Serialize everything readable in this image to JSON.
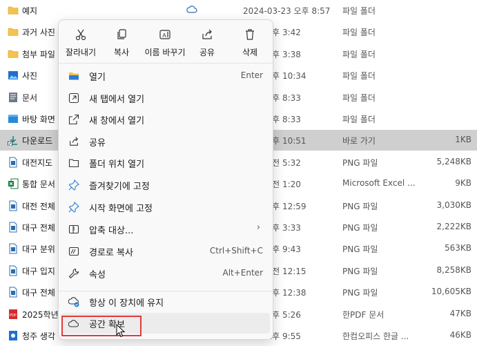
{
  "files": [
    {
      "name": "예지",
      "date": "2024-03-23 오후 8:57",
      "type": "파일 폴더",
      "size": "",
      "icon": "folder-icon",
      "synced": true
    },
    {
      "name": "과거 사진",
      "date": "7-03 오후 3:42",
      "type": "파일 폴더",
      "size": "",
      "icon": "folder-icon"
    },
    {
      "name": "첨부 파일",
      "date": "7-22 오후 3:38",
      "type": "파일 폴더",
      "size": "",
      "icon": "folder-icon"
    },
    {
      "name": "사진",
      "date": "3-02 오후 10:34",
      "type": "파일 폴더",
      "size": "",
      "icon": "pictures-folder-icon"
    },
    {
      "name": "문서",
      "date": "3-05 오후 8:33",
      "type": "파일 폴더",
      "size": "",
      "icon": "documents-folder-icon"
    },
    {
      "name": "바탕 화면",
      "date": "3-05 오후 8:33",
      "type": "파일 폴더",
      "size": "",
      "icon": "desktop-folder-icon"
    },
    {
      "name": "다운로드",
      "date": "5-20 오후 10:51",
      "type": "바로 가기",
      "size": "1KB",
      "icon": "shortcut-icon",
      "selected": true
    },
    {
      "name": "대전지도",
      "date": "1-20 오전 5:32",
      "type": "PNG 파일",
      "size": "5,248KB",
      "icon": "png-file-icon"
    },
    {
      "name": "통합 문서",
      "date": "3-24 오전 1:20",
      "type": "Microsoft Excel ...",
      "size": "9KB",
      "icon": "excel-file-icon"
    },
    {
      "name": "대전 전체",
      "date": "9-02 오후 12:59",
      "type": "PNG 파일",
      "size": "3,030KB",
      "icon": "png-file-icon"
    },
    {
      "name": "대구 전체",
      "date": "1-05 오후 3:33",
      "type": "PNG 파일",
      "size": "2,222KB",
      "icon": "png-file-icon"
    },
    {
      "name": "대구 분위",
      "date": "1-05 오후 9:43",
      "type": "PNG 파일",
      "size": "563KB",
      "icon": "png-file-icon"
    },
    {
      "name": "대구 입지",
      "date": "1-10 오전 12:15",
      "type": "PNG 파일",
      "size": "8,258KB",
      "icon": "png-file-icon"
    },
    {
      "name": "대구 전체",
      "date": "1-11 오후 12:38",
      "type": "PNG 파일",
      "size": "10,605KB",
      "icon": "png-file-icon"
    },
    {
      "name": "2025학년",
      "date": "2-12 오후 5:26",
      "type": "한PDF 문서",
      "size": "47KB",
      "icon": "pdf-file-icon"
    },
    {
      "name": "청주 생각",
      "date": "2-30 오후 9:55",
      "type": "한컴오피스 한글 ...",
      "size": "46KB",
      "icon": "hwp-file-icon"
    }
  ],
  "quick_actions": [
    {
      "label": "잘라내기",
      "icon": "scissors-icon"
    },
    {
      "label": "복사",
      "icon": "copy-icon"
    },
    {
      "label": "이름 바꾸기",
      "icon": "rename-icon"
    },
    {
      "label": "공유",
      "icon": "share-icon"
    },
    {
      "label": "삭제",
      "icon": "trash-icon"
    }
  ],
  "menu_items": [
    {
      "label": "열기",
      "shortcut": "Enter",
      "icon": "open-folder-icon"
    },
    {
      "label": "새 탭에서 열기",
      "shortcut": "",
      "icon": "new-tab-icon"
    },
    {
      "label": "새 창에서 열기",
      "shortcut": "",
      "icon": "new-window-icon"
    },
    {
      "label": "공유",
      "shortcut": "",
      "icon": "share-icon"
    },
    {
      "label": "폴더 위치 열기",
      "shortcut": "",
      "icon": "folder-outline-icon"
    },
    {
      "label": "즐겨찾기에 고정",
      "shortcut": "",
      "icon": "pin-icon"
    },
    {
      "label": "시작 화면에 고정",
      "shortcut": "",
      "icon": "pin-start-icon"
    },
    {
      "label": "압축 대상...",
      "shortcut": "",
      "icon": "zip-icon",
      "submenu": true
    },
    {
      "label": "경로로 복사",
      "shortcut": "Ctrl+Shift+C",
      "icon": "copy-path-icon"
    },
    {
      "label": "속성",
      "shortcut": "Alt+Enter",
      "icon": "wrench-icon"
    },
    {
      "label": "항상 이 장치에 유지",
      "shortcut": "",
      "icon": "cloud-check-icon"
    },
    {
      "label": "공간 확보",
      "shortcut": "",
      "icon": "cloud-icon",
      "hovered": true
    }
  ],
  "submenu_arrow": "›",
  "colors": {
    "selected_row": "#cfcfcf",
    "highlight": "#e03a3a",
    "accent": "#0f6cbd",
    "folder": "#f4c24d"
  }
}
